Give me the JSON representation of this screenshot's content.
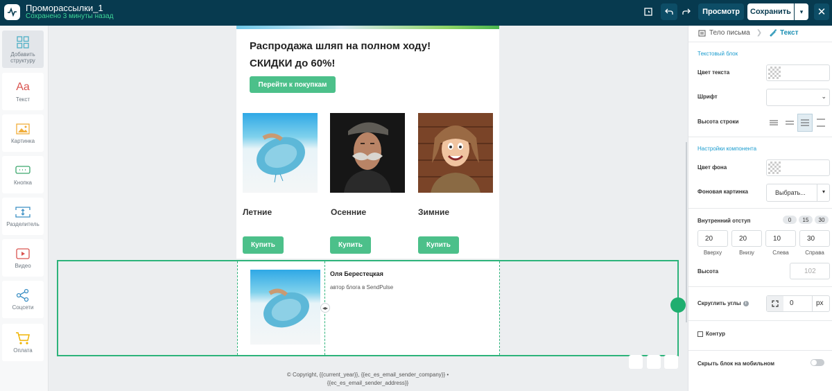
{
  "header": {
    "title": "Проморассылки_1",
    "status": "Сохранено 3 минуты назад",
    "preview_label": "Просмотр",
    "save_label": "Сохранить",
    "close_label": "✕"
  },
  "sidebar": {
    "items": [
      {
        "label": "Добавить структуру",
        "icon": "grid-icon"
      },
      {
        "label": "Текст",
        "icon": "text-icon"
      },
      {
        "label": "Картинка",
        "icon": "image-icon"
      },
      {
        "label": "Кнопка",
        "icon": "button-icon"
      },
      {
        "label": "Разделитель",
        "icon": "divider-icon"
      },
      {
        "label": "Видео",
        "icon": "video-icon"
      },
      {
        "label": "Соцсети",
        "icon": "share-icon"
      },
      {
        "label": "Оплата",
        "icon": "cart-icon"
      }
    ]
  },
  "email": {
    "headline_line1": "Распродажа шляп на полном ходу!",
    "headline_line2": "СКИДКИ до 60%!",
    "cta_label": "Перейти к покупкам",
    "products": [
      {
        "name": "Летние",
        "buy": "Купить"
      },
      {
        "name": "Осенние",
        "buy": "Купить"
      },
      {
        "name": "Зимние",
        "buy": "Купить"
      }
    ],
    "author_name": "Оля Берестецкая",
    "author_role": "автор блога в SendPulse",
    "footer_line1": "© Copyright, {{current_year}}, {{ec_es_email_sender_company}} •",
    "footer_line2": "{{ec_es_email_sender_address}}"
  },
  "panel": {
    "tab_body": "Тело письма",
    "tab_text": "Текст",
    "section_text_block": "Текстовый блок",
    "text_color_label": "Цвет текста",
    "font_label": "Шрифт",
    "line_height_label": "Высота строки",
    "section_component": "Настройки компонента",
    "bg_color_label": "Цвет фона",
    "bg_image_label": "Фоновая картинка",
    "choose_label": "Выбрать...",
    "padding_label": "Внутренний отступ",
    "quick_values": [
      "0",
      "15",
      "30"
    ],
    "padding": {
      "top": "20",
      "bottom": "20",
      "left": "10",
      "right": "30",
      "top_label": "Вверху",
      "bottom_label": "Внизу",
      "left_label": "Слева",
      "right_label": "Справа"
    },
    "height_label": "Высота",
    "height_placeholder": "102",
    "rounding_label": "Скруглить углы",
    "rounding_value": "0",
    "rounding_unit": "px",
    "outline_label": "Контур",
    "hide_mobile_label": "Скрыть блок на мобильном"
  },
  "colors": {
    "header_bg": "#073a4f",
    "accent_green": "#4cc08a",
    "selection_green": "#2cb37a",
    "link_blue": "#1b9ccf"
  }
}
